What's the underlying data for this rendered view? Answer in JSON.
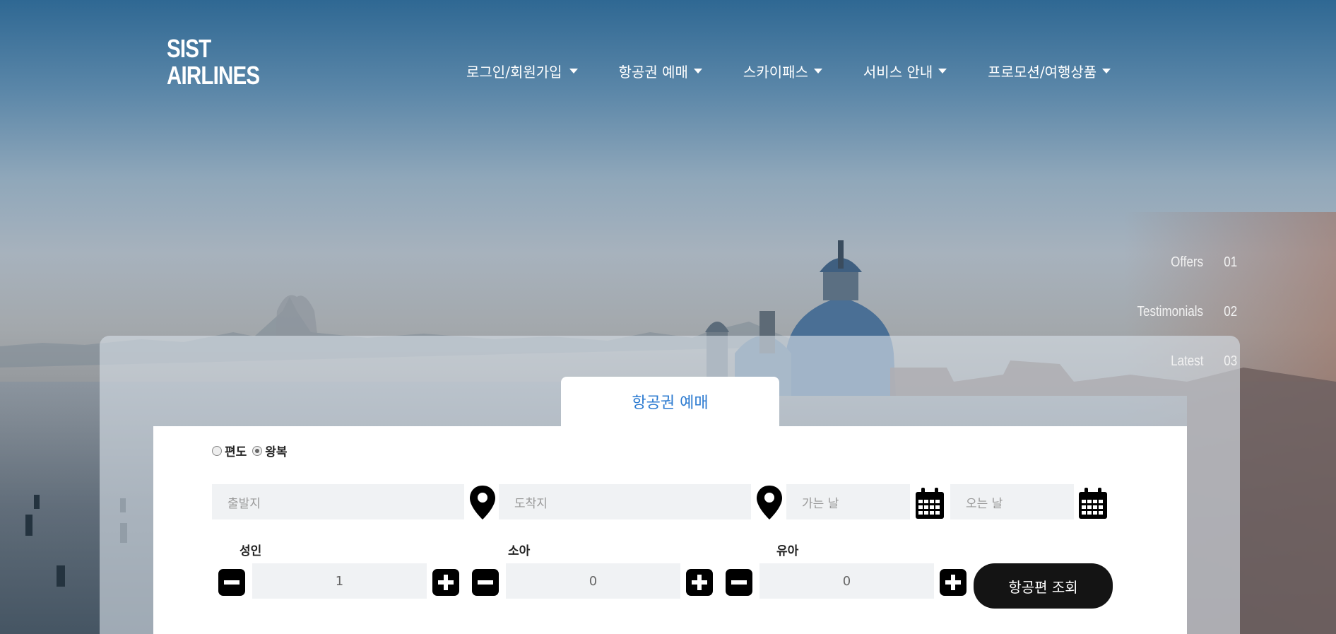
{
  "brand": {
    "line1": "SIST",
    "line2": "AIRLINES"
  },
  "nav": [
    {
      "label": "로그인/회원가입"
    },
    {
      "label": "항공권 예매"
    },
    {
      "label": "스카이패스"
    },
    {
      "label": "서비스 안내"
    },
    {
      "label": "프로모션/여행상품"
    }
  ],
  "side_nav": [
    {
      "label": "Offers",
      "num": "01"
    },
    {
      "label": "Testimonials",
      "num": "02"
    },
    {
      "label": "Latest",
      "num": "03"
    }
  ],
  "booking": {
    "tab_label": "항공권 예매",
    "trip_type": {
      "one_way": "편도",
      "round_trip": "왕복",
      "selected": "왕복"
    },
    "origin_placeholder": "출발지",
    "destination_placeholder": "도착지",
    "depart_placeholder": "가는 날",
    "return_placeholder": "오는 날",
    "adult": {
      "label": "성인",
      "value": "1"
    },
    "child": {
      "label": "소아",
      "value": "0"
    },
    "infant": {
      "label": "유아",
      "value": "0"
    },
    "search_label": "항공편 조회"
  },
  "colors": {
    "tab_text": "#2b7ad0",
    "button_bg": "#141414",
    "field_bg": "#f0f2f4"
  },
  "icons": {
    "location": "map-pin-icon",
    "date": "calendar-icon",
    "minus": "minus-icon",
    "plus": "plus-icon"
  }
}
